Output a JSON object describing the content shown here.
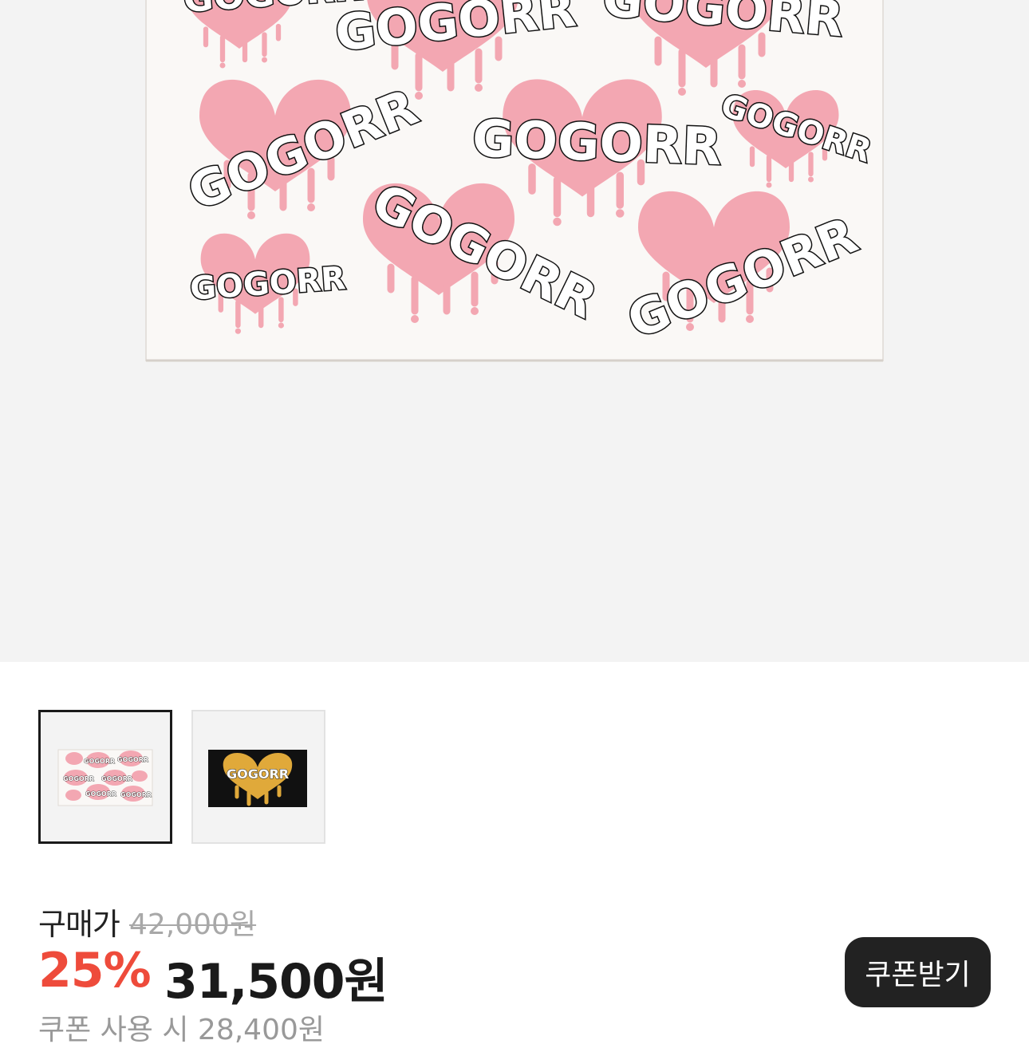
{
  "product": {
    "image_alt": "GOGORR heart pattern towel",
    "logo_text": "GOGORR"
  },
  "thumbnails": [
    {
      "name": "pink-heart-towel",
      "selected": true
    },
    {
      "name": "black-gold-heart-towel",
      "selected": false
    }
  ],
  "price": {
    "label": "구매가",
    "original": "42,000원",
    "discount_rate": "25%",
    "sale": "31,500원",
    "coupon_price": "쿠폰 사용 시 28,400원"
  },
  "coupon_button": "쿠폰받기",
  "colors": {
    "discount": "#ee4b3b",
    "heart_pink": "#f3a7b2",
    "button_bg": "#222222"
  }
}
